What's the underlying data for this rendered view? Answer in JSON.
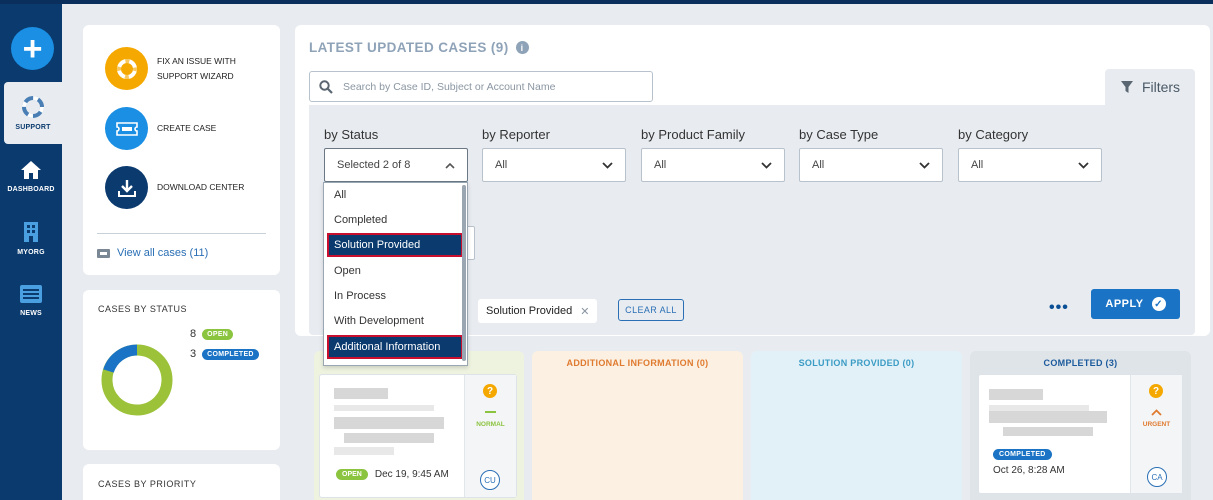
{
  "nav": {
    "add_label": "+",
    "items": [
      {
        "label": "SUPPORT"
      },
      {
        "label": "DASHBOARD"
      },
      {
        "label": "MYORG"
      },
      {
        "label": "NEWS"
      }
    ]
  },
  "quick_actions": {
    "items": [
      {
        "label_line1": "FIX AN ISSUE WITH",
        "label_line2": "SUPPORT WIZARD",
        "icon": "lifebuoy-icon",
        "color": "#f5a800"
      },
      {
        "label_line1": "CREATE CASE",
        "label_line2": "",
        "icon": "ticket-icon",
        "color": "#1a8fe3"
      },
      {
        "label_line1": "DOWNLOAD CENTER",
        "label_line2": "",
        "icon": "download-icon",
        "color": "#0a3a6e"
      }
    ],
    "view_all": "View all cases (11)"
  },
  "cases_by_status": {
    "title": "CASES BY STATUS",
    "stats": [
      {
        "count": "8",
        "label": "OPEN",
        "color": "#8bc43f"
      },
      {
        "count": "3",
        "label": "COMPLETED",
        "color": "#1a73c4"
      }
    ]
  },
  "cases_by_priority": {
    "title": "CASES BY PRIORITY"
  },
  "main": {
    "title": "LATEST UPDATED CASES (9)",
    "info": "i",
    "search_placeholder": "Search by Case ID, Subject or Account Name",
    "filters_tab": "Filters",
    "filters": [
      {
        "label": "by Status",
        "value": "Selected 2 of 8"
      },
      {
        "label": "by Reporter",
        "value": "All"
      },
      {
        "label": "by Product Family",
        "value": "All"
      },
      {
        "label": "by Case Type",
        "value": "All"
      },
      {
        "label": "by Category",
        "value": "All"
      }
    ],
    "status_options": [
      "All",
      "Completed",
      "Solution Provided",
      "Open",
      "In Process",
      "With Development",
      "Additional Information"
    ],
    "selected_options": [
      "Solution Provided",
      "Additional Information"
    ],
    "chip": "Solution Provided",
    "clear_all": "CLEAR ALL",
    "more": "•••",
    "apply": "APPLY"
  },
  "board": {
    "columns": [
      {
        "title": "",
        "bg": "#eef3e0"
      },
      {
        "title": "ADDITIONAL INFORMATION (0)",
        "bg": "#fbf0e2",
        "color": "#e07a2f"
      },
      {
        "title": "SOLUTION PROVIDED (0)",
        "bg": "#e2f1f8",
        "color": "#3a9bc4"
      },
      {
        "title": "COMPLETED (3)",
        "bg": "#dfe4e9",
        "color": "#1a5a9c"
      }
    ],
    "card1": {
      "status": "OPEN",
      "date": "Dec 19, 9:45 AM",
      "priority": "NORMAL",
      "avatar": "CU",
      "q": "?"
    },
    "card2": {
      "status": "COMPLETED",
      "date": "Oct 26, 8:28 AM",
      "priority": "URGENT",
      "avatar": "CA",
      "q": "?"
    }
  }
}
